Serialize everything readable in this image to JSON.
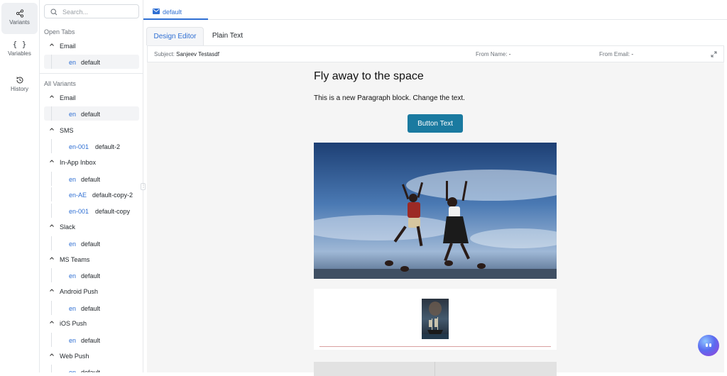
{
  "rail": {
    "items": [
      {
        "label": "Variants",
        "icon": "share-icon",
        "active": true
      },
      {
        "label": "Variables",
        "icon": "braces-icon",
        "glyph": "{ }"
      },
      {
        "label": "History",
        "icon": "history-icon"
      }
    ]
  },
  "tree": {
    "search_placeholder": "Search...",
    "open_tabs_title": "Open Tabs",
    "open_tabs": [
      {
        "group": "Email",
        "variants": [
          {
            "lang": "en",
            "name": "default",
            "active": true
          }
        ]
      }
    ],
    "all_variants_title": "All Variants",
    "groups": [
      {
        "name": "Email",
        "variants": [
          {
            "lang": "en",
            "name": "default",
            "active": true
          }
        ]
      },
      {
        "name": "SMS",
        "variants": [
          {
            "lang": "en-001",
            "name": "default-2"
          }
        ]
      },
      {
        "name": "In-App Inbox",
        "variants": [
          {
            "lang": "en",
            "name": "default"
          },
          {
            "lang": "en-AE",
            "name": "default-copy-2"
          },
          {
            "lang": "en-001",
            "name": "default-copy"
          }
        ]
      },
      {
        "name": "Slack",
        "variants": [
          {
            "lang": "en",
            "name": "default"
          }
        ]
      },
      {
        "name": "MS Teams",
        "variants": [
          {
            "lang": "en",
            "name": "default"
          }
        ]
      },
      {
        "name": "Android Push",
        "variants": [
          {
            "lang": "en",
            "name": "default"
          }
        ]
      },
      {
        "name": "iOS Push",
        "variants": [
          {
            "lang": "en",
            "name": "default"
          }
        ]
      },
      {
        "name": "Web Push",
        "variants": [
          {
            "lang": "en",
            "name": "default"
          }
        ]
      }
    ]
  },
  "doc_tab": {
    "label": "default",
    "icon": "mail-icon"
  },
  "editor_tabs": [
    {
      "label": "Design Editor",
      "active": true
    },
    {
      "label": "Plain Text",
      "active": false
    }
  ],
  "meta": {
    "subject_key": "Subject:",
    "subject_value": "Sanjeev Testasdf",
    "from_name_key": "From Name:",
    "from_name_value": "-",
    "from_email_key": "From Email:",
    "from_email_value": "-"
  },
  "email": {
    "title": "Fly away to the space",
    "paragraph": "This is a new Paragraph block. Change the text.",
    "button_label": "Button Text"
  },
  "colors": {
    "accent": "#2f6fd3",
    "button": "#1a7aa0"
  }
}
